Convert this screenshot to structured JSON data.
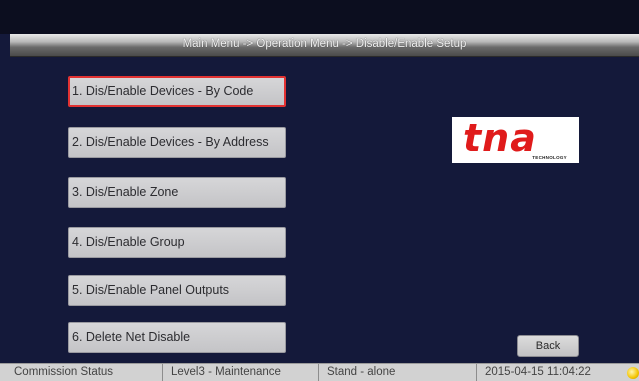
{
  "header": {
    "breadcrumb": "Main Menu -> Operation Menu -> Disable/Enable Setup"
  },
  "menu": {
    "items": [
      {
        "label": "1. Dis/Enable Devices - By Code",
        "selected": true
      },
      {
        "label": "2. Dis/Enable Devices - By Address",
        "selected": false
      },
      {
        "label": "3. Dis/Enable Zone",
        "selected": false
      },
      {
        "label": "4. Dis/Enable Group",
        "selected": false
      },
      {
        "label": "5. Dis/Enable Panel Outputs",
        "selected": false
      },
      {
        "label": "6. Delete Net Disable",
        "selected": false
      }
    ]
  },
  "logo": {
    "word": "tna",
    "tagline": "TECHNOLOGY",
    "color": "#e01b1b"
  },
  "back_label": "Back",
  "status": {
    "commission": "Commission Status",
    "access_level": "Level3 - Maintenance",
    "mode": "Stand - alone",
    "datetime": "2015-04-15 11:04:22",
    "indicator_icon": "bulb-icon"
  },
  "colors": {
    "background": "#14193a",
    "selected_border": "#e23232"
  }
}
